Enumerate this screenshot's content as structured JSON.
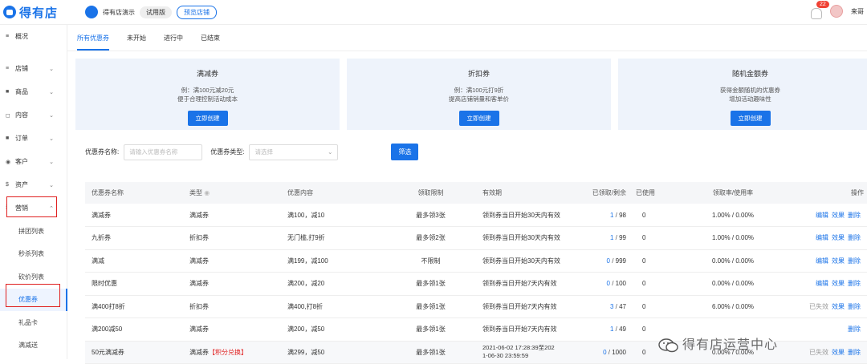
{
  "brand": {
    "logo_text": "得有店"
  },
  "topbar": {
    "shop_name": "得有店演示",
    "trial_tag": "试用版",
    "preview_button": "预览店铺",
    "notification_count": "22",
    "username": "来哥"
  },
  "sidebar": {
    "items": [
      {
        "icon": "≡",
        "label": "概况"
      },
      {
        "icon": "≡",
        "label": "店铺"
      },
      {
        "icon": "■",
        "label": "商品"
      },
      {
        "icon": "◻",
        "label": "内容"
      },
      {
        "icon": "■",
        "label": "订单"
      },
      {
        "icon": "◉",
        "label": "客户"
      },
      {
        "icon": "$",
        "label": "资产"
      },
      {
        "icon": "⁞",
        "label": "营销"
      }
    ],
    "sub_items": [
      "拼团列表",
      "秒杀列表",
      "砍价列表",
      "优惠券",
      "礼品卡",
      "满减送"
    ]
  },
  "tabs": [
    "所有优惠券",
    "未开始",
    "进行中",
    "已结束"
  ],
  "cards": [
    {
      "title": "满减券",
      "desc1": "例：满100元减20元",
      "desc2": "便于合理控制活动成本",
      "button": "立即创建"
    },
    {
      "title": "折扣券",
      "desc1": "例：满100元打9折",
      "desc2": "提高店铺销量和客单价",
      "button": "立即创建"
    },
    {
      "title": "随机金额券",
      "desc1": "获得金额随机的优惠券",
      "desc2": "增加活动趣味性",
      "button": "立即创建"
    }
  ],
  "filter": {
    "name_label": "优惠券名称:",
    "name_placeholder": "请输入优惠券名称",
    "type_label": "优惠券类型:",
    "type_placeholder": "请选择",
    "button": "筛选"
  },
  "table": {
    "headers": [
      "优惠券名称",
      "类型",
      "优惠内容",
      "领取限制",
      "有效期",
      "已领取/剩余",
      "已使用",
      "领取率/使用率",
      "操作"
    ],
    "rows": [
      {
        "name": "满减券",
        "type": "满减券",
        "tag": "",
        "content": "满100，减10",
        "limit": "最多领3张",
        "validity": "领到券当日开始30天内有效",
        "validity2": "",
        "claimed": "1",
        "remain": "98",
        "used": "0",
        "rate": "1.00% / 0.00%",
        "ops": [
          "编辑",
          "效果",
          "删除"
        ],
        "first_gray": false
      },
      {
        "name": "九折券",
        "type": "折扣券",
        "tag": "",
        "content": "无门槛,打9折",
        "limit": "最多领2张",
        "validity": "领到券当日开始30天内有效",
        "validity2": "",
        "claimed": "1",
        "remain": "99",
        "used": "0",
        "rate": "1.00% / 0.00%",
        "ops": [
          "编辑",
          "效果",
          "删除"
        ],
        "first_gray": false
      },
      {
        "name": "满减",
        "type": "满减券",
        "tag": "",
        "content": "满199，减100",
        "limit": "不限制",
        "validity": "领到券当日开始30天内有效",
        "validity2": "",
        "claimed": "0",
        "remain": "999",
        "used": "0",
        "rate": "0.00% / 0.00%",
        "ops": [
          "编辑",
          "效果",
          "删除"
        ],
        "first_gray": false
      },
      {
        "name": "限时优惠",
        "type": "满减券",
        "tag": "",
        "content": "满200，减20",
        "limit": "最多领1张",
        "validity": "领到券当日开始7天内有效",
        "validity2": "",
        "claimed": "0",
        "remain": "100",
        "used": "0",
        "rate": "0.00% / 0.00%",
        "ops": [
          "编辑",
          "效果",
          "删除"
        ],
        "first_gray": false
      },
      {
        "name": "满400打8折",
        "type": "折扣券",
        "tag": "",
        "content": "满400,打8折",
        "limit": "最多领1张",
        "validity": "领到券当日开始7天内有效",
        "validity2": "",
        "claimed": "3",
        "remain": "47",
        "used": "0",
        "rate": "6.00% / 0.00%",
        "ops": [
          "已失效",
          "效果",
          "删除"
        ],
        "first_gray": true
      },
      {
        "name": "满200减50",
        "type": "满减券",
        "tag": "",
        "content": "满200，减50",
        "limit": "最多领1张",
        "validity": "领到券当日开始7天内有效",
        "validity2": "",
        "claimed": "1",
        "remain": "49",
        "used": "0",
        "rate": "",
        "ops": [
          "删除"
        ],
        "first_gray": false
      },
      {
        "name": "50元满减券",
        "type": "满减券",
        "tag": "【积分兑换】",
        "content": "满299，减50",
        "limit": "最多领1张",
        "validity": "2021-06-02 17:28:39至202",
        "validity2": "1-06-30 23:59:59",
        "claimed": "0",
        "remain": "1000",
        "used": "0",
        "rate": "0.00% / 0.00%",
        "ops": [
          "已失效",
          "效果",
          "删除"
        ],
        "first_gray": true
      }
    ]
  },
  "watermark": "得有店运营中心"
}
